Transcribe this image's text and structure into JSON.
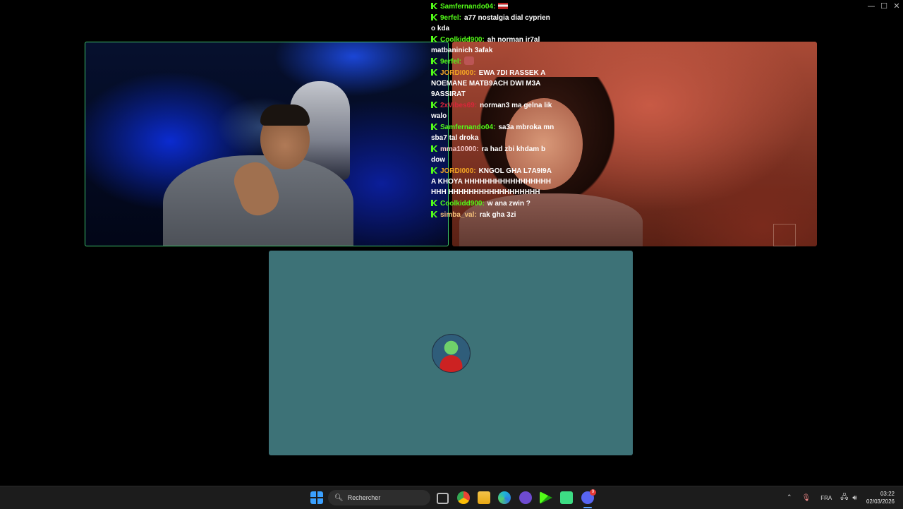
{
  "window_controls": {
    "minimize": "—",
    "maximize": "☐",
    "close": "✕"
  },
  "chat": {
    "messages": [
      {
        "user": "Samfernando04",
        "text": "",
        "user_color": "#53fc18",
        "has_flag": true
      },
      {
        "user": "9erfel",
        "text": "a77 nostalgia dial cyprien o kda",
        "user_color": "#53fc18"
      },
      {
        "user": "Coolkidd900",
        "text": "ah norman ir7al matbaninich 3afak",
        "user_color": "#53fc18"
      },
      {
        "user": "9erfel",
        "text": "",
        "user_color": "#53fc18",
        "has_emote": true
      },
      {
        "user": "JORDI000",
        "text": "EWA 7DI RASSEK A NOEMANE MATB9ACH DWI M3A 9ASSIRAT",
        "user_color": "#f5a623"
      },
      {
        "user": "2xVibes69",
        "text": "norman3 ma gelna lik walo",
        "user_color": "#d9263a"
      },
      {
        "user": "Samfernando04",
        "text": "sa3a mbroka mn sba7 tal droka",
        "user_color": "#53fc18"
      },
      {
        "user": "mma10000",
        "text": "ra had zbi khdam b dow",
        "user_color": "#f5c6c6"
      },
      {
        "user": "JORDI000",
        "text": "KNGOL GHA L7A9I9A A KHOYA HHHHHHHHHHHHHHHHHHHH HHHHHHHHHHHHHHHHHH",
        "user_color": "#f5a623"
      },
      {
        "user": "Coolkidd900",
        "text": "w ana zwin ?",
        "user_color": "#53fc18"
      },
      {
        "user": "simba_val",
        "text": "rak gha 3zi",
        "user_color": "#f5c07a"
      }
    ]
  },
  "taskbar": {
    "search_placeholder": "Rechercher",
    "language": "FRA",
    "time": "03:22",
    "date": "02/03/2026",
    "discord_badge": "9"
  }
}
